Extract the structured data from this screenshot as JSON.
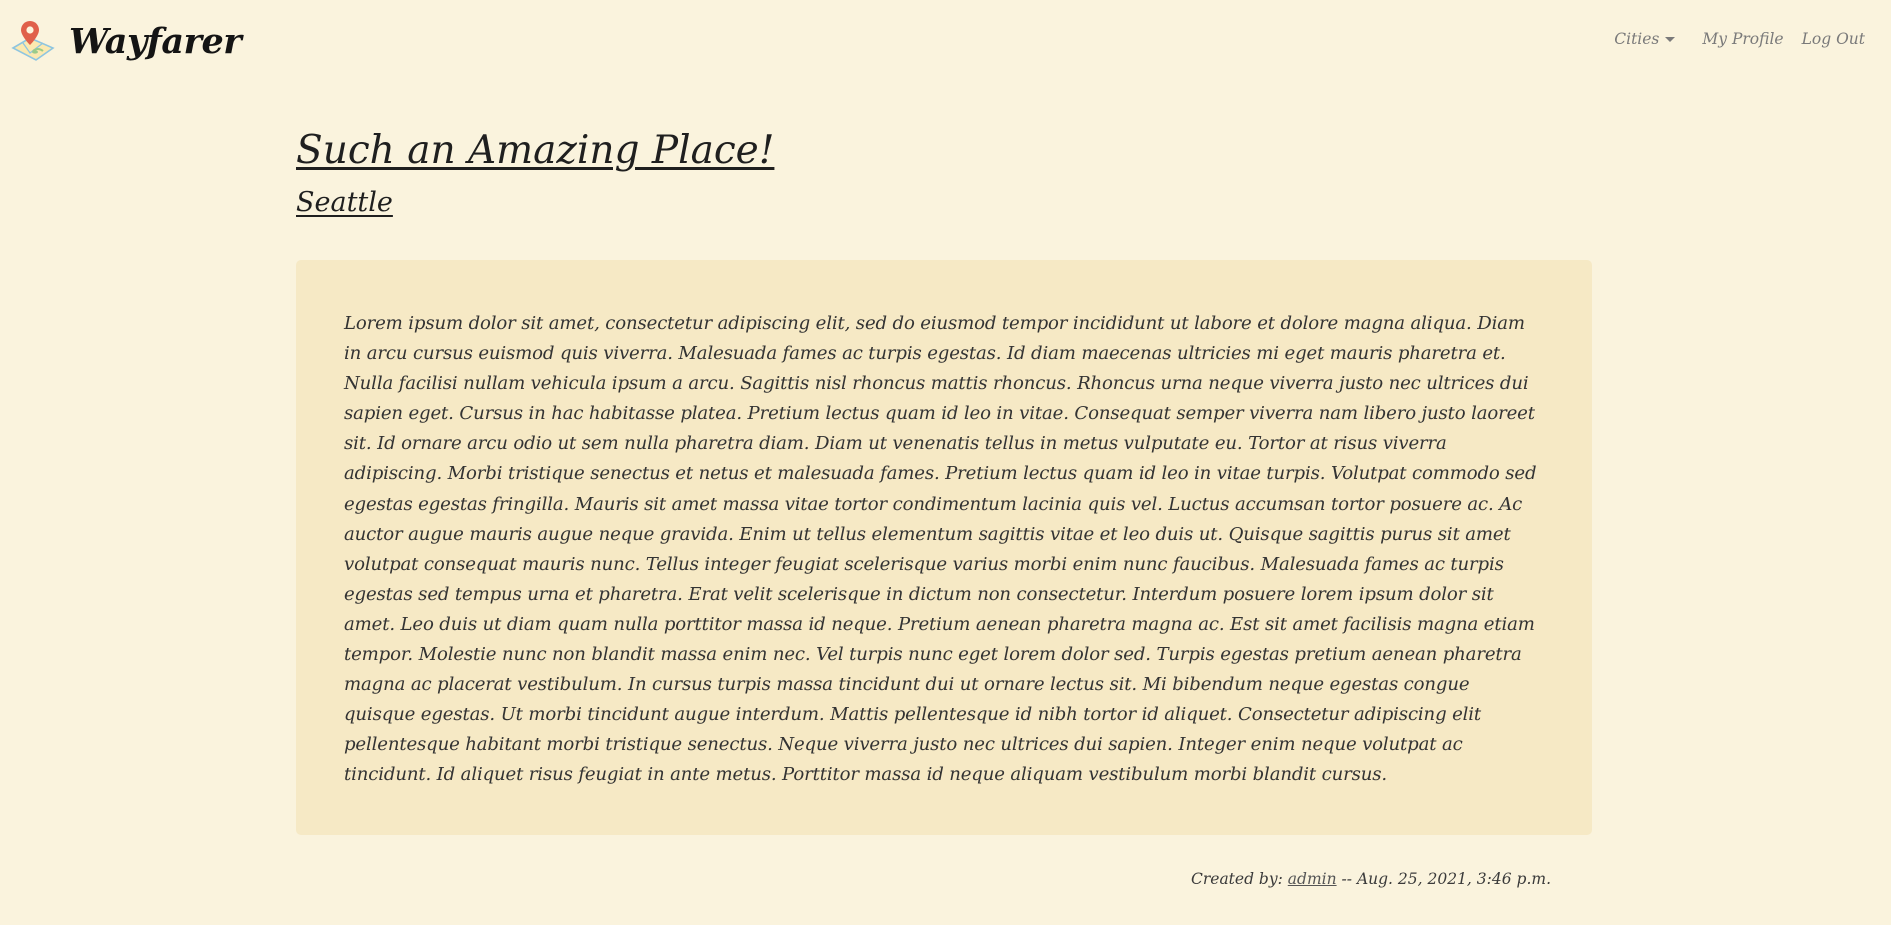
{
  "nav": {
    "brand": "Wayfarer",
    "brand_icon": "map-pin-logo-icon",
    "cities_label": "Cities",
    "profile_label": "My Profile",
    "logout_label": "Log Out"
  },
  "post": {
    "title": "Such an Amazing Place!",
    "city": "Seattle",
    "body": "Lorem ipsum dolor sit amet, consectetur adipiscing elit, sed do eiusmod tempor incididunt ut labore et dolore magna aliqua. Diam in arcu cursus euismod quis viverra. Malesuada fames ac turpis egestas. Id diam maecenas ultricies mi eget mauris pharetra et. Nulla facilisi nullam vehicula ipsum a arcu. Sagittis nisl rhoncus mattis rhoncus. Rhoncus urna neque viverra justo nec ultrices dui sapien eget. Cursus in hac habitasse platea. Pretium lectus quam id leo in vitae. Consequat semper viverra nam libero justo laoreet sit. Id ornare arcu odio ut sem nulla pharetra diam. Diam ut venenatis tellus in metus vulputate eu. Tortor at risus viverra adipiscing. Morbi tristique senectus et netus et malesuada fames. Pretium lectus quam id leo in vitae turpis. Volutpat commodo sed egestas egestas fringilla. Mauris sit amet massa vitae tortor condimentum lacinia quis vel. Luctus accumsan tortor posuere ac. Ac auctor augue mauris augue neque gravida. Enim ut tellus elementum sagittis vitae et leo duis ut. Quisque sagittis purus sit amet volutpat consequat mauris nunc. Tellus integer feugiat scelerisque varius morbi enim nunc faucibus. Malesuada fames ac turpis egestas sed tempus urna et pharetra. Erat velit scelerisque in dictum non consectetur. Interdum posuere lorem ipsum dolor sit amet. Leo duis ut diam quam nulla porttitor massa id neque. Pretium aenean pharetra magna ac. Est sit amet facilisis magna etiam tempor. Molestie nunc non blandit massa enim nec. Vel turpis nunc eget lorem dolor sed. Turpis egestas pretium aenean pharetra magna ac placerat vestibulum. In cursus turpis massa tincidunt dui ut ornare lectus sit. Mi bibendum neque egestas congue quisque egestas. Ut morbi tincidunt augue interdum. Mattis pellentesque id nibh tortor id aliquet. Consectetur adipiscing elit pellentesque habitant morbi tristique senectus. Neque viverra justo nec ultrices dui sapien. Integer enim neque volutpat ac tincidunt. Id aliquet risus feugiat in ante metus. Porttitor massa id neque aliquam vestibulum morbi blandit cursus.",
    "created_by_label": "Created by:",
    "author": "admin",
    "separator": "--",
    "timestamp": "Aug. 25, 2021, 3:46 p.m."
  },
  "colors": {
    "page_bg": "#faf3dd",
    "card_bg": "#f6e9c5",
    "text": "#2b2b2b",
    "nav_text": "#7a7a7a",
    "pin_red": "#e0604a",
    "map_blue": "#8ec5e0",
    "map_yellow": "#f2d36b"
  }
}
